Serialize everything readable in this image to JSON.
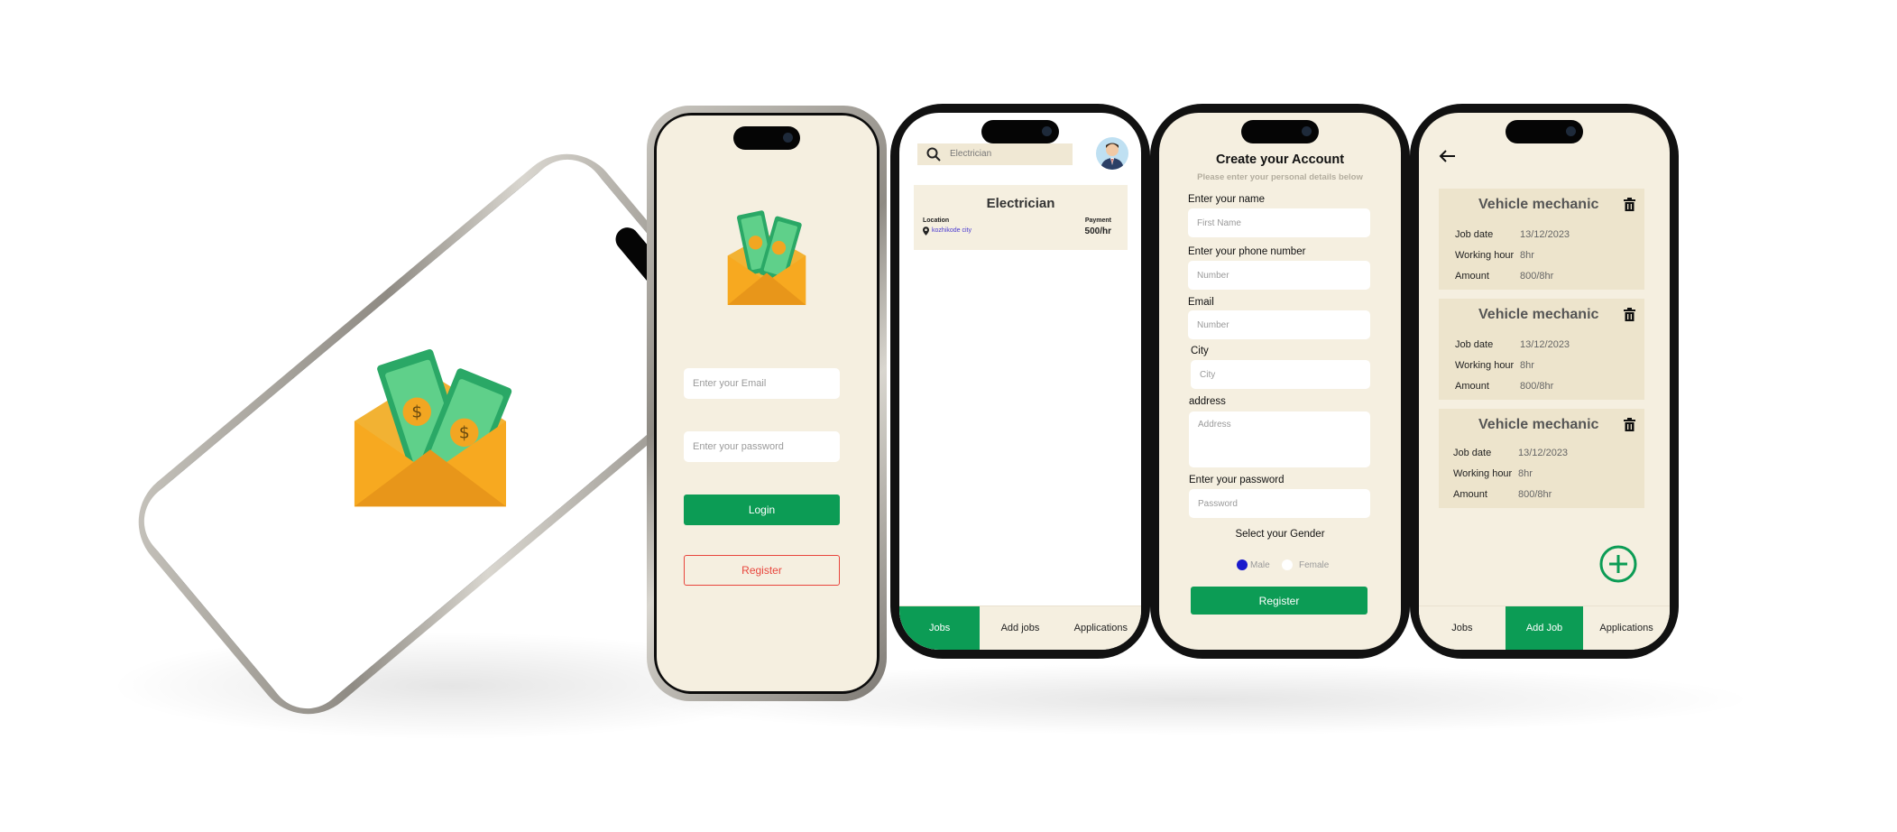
{
  "splash": {
    "icon": "money-envelope-icon"
  },
  "login": {
    "email_placeholder": "Enter your Email",
    "password_placeholder": "Enter your password",
    "login_label": "Login",
    "register_label": "Register",
    "icon": "money-envelope-icon"
  },
  "jobs": {
    "search_value": "Electrician",
    "card": {
      "title": "Electrician",
      "location_label": "Location",
      "location_value": "kozhikode city",
      "payment_label": "Payment",
      "payment_value": "500/hr"
    },
    "nav": [
      "Jobs",
      "Add jobs",
      "Applications"
    ],
    "active_tab": 0
  },
  "register": {
    "title": "Create your Account",
    "subtitle": "Please enter your personal details below",
    "fields": [
      {
        "label": "Enter your name",
        "placeholder": "First Name"
      },
      {
        "label": "Enter your phone number",
        "placeholder": "Number"
      },
      {
        "label": "Email",
        "placeholder": "Number"
      },
      {
        "label": "City",
        "placeholder": "City"
      },
      {
        "label": "address",
        "placeholder": "Address"
      },
      {
        "label": "Enter your password",
        "placeholder": "Password"
      }
    ],
    "gender_label": "Select your Gender",
    "gender_options": [
      "Male",
      "Female"
    ],
    "selected_gender": "Male",
    "submit_label": "Register"
  },
  "posted_jobs": {
    "cards": [
      {
        "title": "Vehicle mechanic",
        "job_date_label": "Job date",
        "job_date": "13/12/2023",
        "hours_label": "Working hour",
        "hours": "8hr",
        "amount_label": "Amount",
        "amount": "800/8hr"
      },
      {
        "title": "Vehicle mechanic",
        "job_date_label": "Job date",
        "job_date": "13/12/2023",
        "hours_label": "Working hour",
        "hours": "8hr",
        "amount_label": "Amount",
        "amount": "800/8hr"
      },
      {
        "title": "Vehicle mechanic",
        "job_date_label": "Job date",
        "job_date": "13/12/2023",
        "hours_label": "Working hour",
        "hours": "8hr",
        "amount_label": "Amount",
        "amount": "800/8hr"
      }
    ],
    "nav": [
      "Jobs",
      "Add Job",
      "Applications"
    ],
    "active_tab": 1
  },
  "colors": {
    "accent_green": "#0c9c55",
    "screen_bg": "#f5efe0",
    "card_bg": "#ede4cc",
    "danger": "#e8453c",
    "radio_selected": "#1a1acc"
  }
}
